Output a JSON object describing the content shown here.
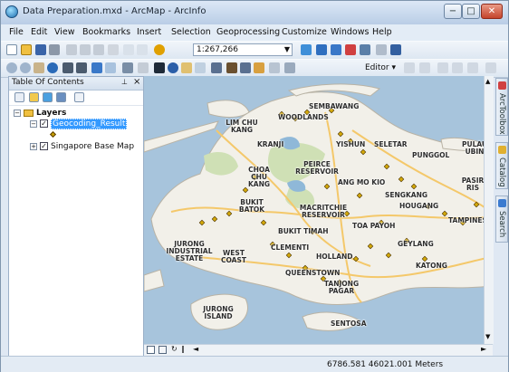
{
  "window": {
    "title": "Data Preparation.mxd - ArcMap - ArcInfo",
    "min_label": "−",
    "max_label": "□",
    "close_label": "✕"
  },
  "menu": [
    "File",
    "Edit",
    "View",
    "Bookmarks",
    "Insert",
    "Selection",
    "Geoprocessing",
    "Customize",
    "Windows",
    "Help"
  ],
  "toolbar": {
    "scale": "1:267,266",
    "editor_label": "Editor ▾"
  },
  "toc": {
    "title": "Table Of Contents",
    "pin": "⊥",
    "close": "×",
    "root": "Layers",
    "layers": [
      {
        "name": "Geocoding_Result",
        "checked": "✓",
        "expander": "−"
      },
      {
        "name": "Singapore Base Map",
        "checked": "✓",
        "expander": "+"
      }
    ]
  },
  "map": {
    "labels": [
      "SEMBAWANG",
      "WOODLANDS",
      "LIM CHU KANG",
      "KRANJI",
      "YISHUN",
      "SELETAR",
      "PUNGGOL",
      "PULAU UBIN",
      "PEIRCE RESERVOIR",
      "ANG MO KIO",
      "CHOA CHU KANG",
      "SENGKANG",
      "HOUGANG",
      "BUKIT BATOK",
      "MACRITCHIE RESERVOIR",
      "BUKIT TIMAH",
      "TOA PAYOH",
      "PASIR RIS",
      "TAMPINES",
      "CLEMENTI",
      "JURONG INDUSTRIAL ESTATE",
      "WEST COAST",
      "GEYLANG",
      "HOLLAND",
      "QUEENSTOWN",
      "KATONG",
      "TANJONG PAGAR",
      "JURONG ISLAND",
      "SENTOSA"
    ],
    "colors": {
      "water": "#a7c4dc",
      "land": "#f2f0e9",
      "park": "#cfe0b5",
      "road": "#f4c86a",
      "point": "#d4a90a"
    }
  },
  "status": {
    "coordinates": "6786.581  46021.001 Meters"
  },
  "side_tabs": [
    "ArcToolbox",
    "Catalog",
    "Search"
  ]
}
